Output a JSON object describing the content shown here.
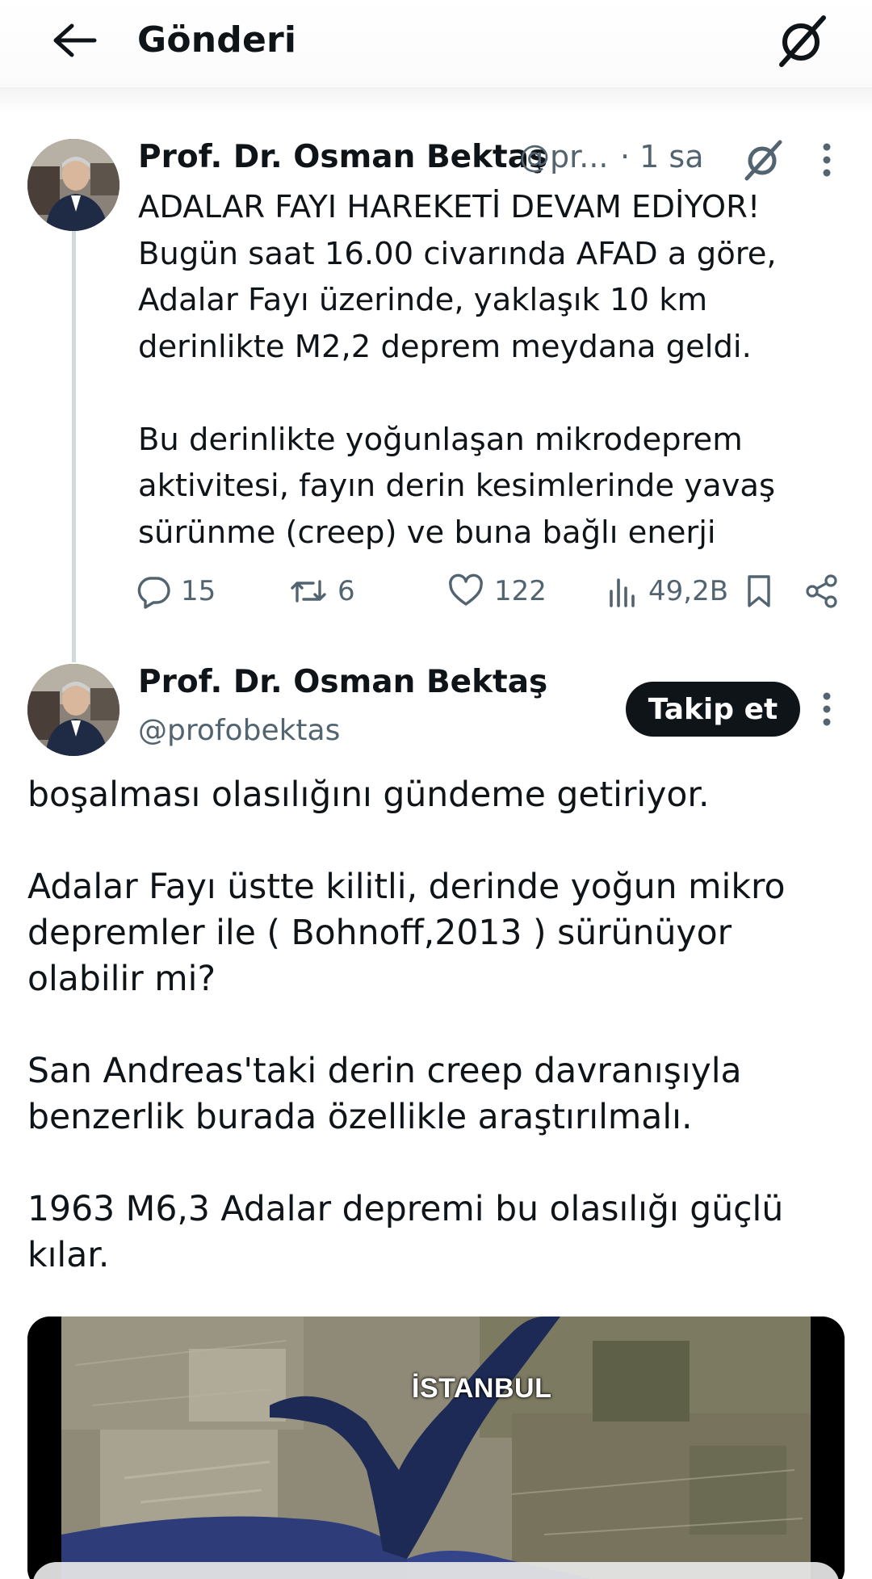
{
  "header": {
    "title": "Gönderi"
  },
  "tweet1": {
    "author_name": "Prof. Dr. Osman Bektaş",
    "author_handle": "@pr...",
    "time": "· 1 sa",
    "lines": [
      "ADALAR FAYI HAREKETİ DEVAM EDİYOR!",
      "Bugün saat 16.00 civarında AFAD a göre,",
      "Adalar Fayı üzerinde, yaklaşık 10 km",
      "derinlikte M2,2 deprem meydana geldi.",
      "",
      "Bu derinlikte yoğunlaşan mikrodeprem",
      "aktivitesi, fayın derin kesimlerinde yavaş",
      "sürünme (creep) ve buna bağlı enerji"
    ],
    "stats": {
      "replies": "15",
      "reposts": "6",
      "likes": "122",
      "views": "49,2B"
    }
  },
  "tweet2": {
    "author_name": "Prof. Dr. Osman Bektaş",
    "author_handle": "@profobektas",
    "follow_label": "Takip et",
    "lines": [
      "boşalması olasılığını gündeme getiriyor.",
      "",
      "Adalar Fayı üstte kilitli, derinde yoğun mikro",
      "depremler ile ( Bohnoff,2013 ) sürünüyor",
      "olabilir mi?",
      "",
      "San Andreas'taki derin creep davranışıyla",
      "benzerlik burada özellikle araştırılmalı.",
      "",
      "1963 M6,3 Adalar depremi bu olasılığı güçlü",
      "kılar."
    ],
    "media": {
      "map_label": "İSTANBUL"
    }
  },
  "icons": {
    "back": "back-arrow-icon",
    "grok": "grok-icon",
    "more": "more-vertical-icon",
    "reply": "reply-icon",
    "repost": "repost-icon",
    "like": "heart-icon",
    "views": "views-icon",
    "bookmark": "bookmark-icon",
    "share": "share-icon"
  },
  "colors": {
    "text": "#0f1419",
    "secondary": "#536471",
    "thread_line": "#cfd9de",
    "follow_button": "#0f1419"
  }
}
